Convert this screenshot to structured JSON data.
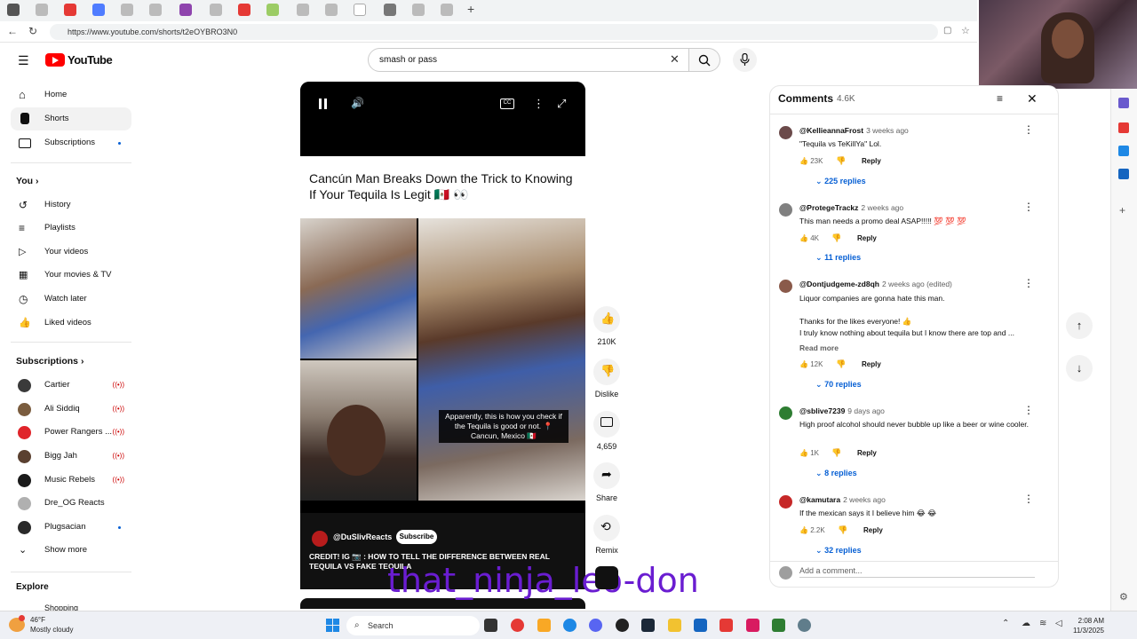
{
  "browser": {
    "url": "https://www.youtube.com/shorts/t2eOYBRO3N0"
  },
  "header": {
    "logo_text": "YouTube",
    "search_value": "smash or pass"
  },
  "sidebar": {
    "nav": [
      {
        "label": "Home"
      },
      {
        "label": "Shorts"
      },
      {
        "label": "Subscriptions"
      }
    ],
    "you_heading": "You",
    "you_items": [
      {
        "label": "History"
      },
      {
        "label": "Playlists"
      },
      {
        "label": "Your videos"
      },
      {
        "label": "Your movies & TV"
      },
      {
        "label": "Watch later"
      },
      {
        "label": "Liked videos"
      }
    ],
    "subs_heading": "Subscriptions",
    "subs": [
      {
        "label": "Cartier",
        "live": "((•))",
        "color": "#3a3a3a"
      },
      {
        "label": "Ali Siddiq",
        "live": "((•))",
        "color": "#7a5c3e"
      },
      {
        "label": "Power Rangers ...",
        "live": "((•))",
        "color": "#e0242a"
      },
      {
        "label": "Bigg Jah",
        "live": "((•))",
        "color": "#5a4030"
      },
      {
        "label": "Music Rebels",
        "live": "((•))",
        "color": "#1a1a1a"
      },
      {
        "label": "Dre_OG Reacts",
        "live": "",
        "color": "#b0b0b0"
      },
      {
        "label": "Plugsacian",
        "live": "",
        "color": "#2a2a2a"
      }
    ],
    "show_more": "Show more",
    "explore_heading": "Explore",
    "explore_partial": "Shopping"
  },
  "video": {
    "title": "Cancún Man Breaks Down the Trick to Knowing If Your Tequila Is Legit 🇲🇽 👀",
    "caption": "Apparently, this is how you check if the Tequila is good or not. 📍Cancun, Mexico 🇲🇽",
    "channel": "@DuSlivReacts",
    "subscribe_label": "Subscribe",
    "description": "CREDIT! IG 📷 : HOW TO TELL THE DIFFERENCE BETWEEN REAL TEQUILA VS FAKE TEQUILA",
    "watermark": "that_ninja_leo-don"
  },
  "actions": {
    "likes": "210K",
    "dislike_label": "Dislike",
    "comments_count": "4,659",
    "share_label": "Share",
    "remix_label": "Remix"
  },
  "comments": {
    "heading": "Comments",
    "count": "4.6K",
    "items": [
      {
        "handle": "@KellieannaFrost",
        "time": "3 weeks ago",
        "text": "\"Tequila vs TeKillYa\" Lol.",
        "likes": "23K",
        "reply": "Reply",
        "replies": "225 replies",
        "color": "#6b4a4a"
      },
      {
        "handle": "@ProtegeTrackz",
        "time": "2 weeks ago",
        "text": "This man needs a promo deal ASAP!!!!! 💯 💯 💯",
        "likes": "4K",
        "reply": "Reply",
        "replies": "11 replies",
        "color": "#808080"
      },
      {
        "handle": "@Dontjudgeme-zd8qh",
        "time": "2 weeks ago (edited)",
        "text": "Liquor companies are gonna hate this man.",
        "text2": "Thanks for the likes everyone! 👍",
        "text3": "I truly know nothing about tequila but I know there are top and ...",
        "read_more": "Read more",
        "likes": "12K",
        "reply": "Reply",
        "replies": "70 replies",
        "color": "#8a5a4a"
      },
      {
        "handle": "@sblive7239",
        "time": "9 days ago",
        "text": "High proof alcohol should never bubble up like a beer or wine cooler.",
        "likes": "1K",
        "reply": "Reply",
        "replies": "8 replies",
        "color": "#2e7d32"
      },
      {
        "handle": "@kamutara",
        "time": "2 weeks ago",
        "text": "If the mexican says it I believe him 😂 😂",
        "likes": "2.2K",
        "reply": "Reply",
        "replies": "32 replies",
        "color": "#c62828"
      }
    ],
    "add_placeholder": "Add a comment..."
  },
  "taskbar": {
    "temp": "46°F",
    "weather": "Mostly cloudy",
    "search": "Search",
    "time": "2:08 AM",
    "date": "11/3/2025"
  }
}
